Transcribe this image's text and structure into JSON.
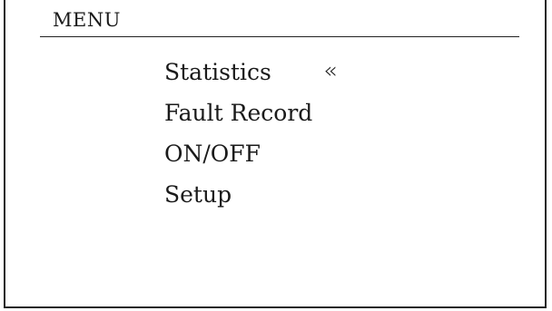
{
  "menu": {
    "title": "MENU",
    "items": [
      {
        "label": "Statistics",
        "selected": true
      },
      {
        "label": "Fault Record",
        "selected": false
      },
      {
        "label": "ON/OFF",
        "selected": false
      },
      {
        "label": "Setup",
        "selected": false
      }
    ],
    "selector_glyph": "«"
  }
}
